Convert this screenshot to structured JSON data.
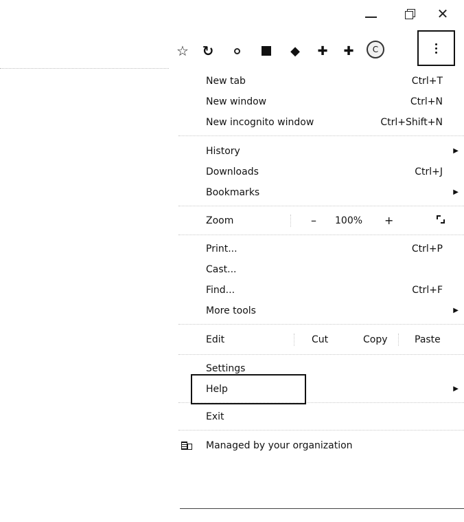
{
  "window_controls": {
    "minimize_icon": "minimize-icon",
    "restore_icon": "restore-icon",
    "close_glyph": "✕"
  },
  "toolbar": {
    "icons": [
      {
        "name": "star-icon",
        "glyph": "☆"
      },
      {
        "name": "refresh-icon",
        "glyph": "↻"
      },
      {
        "name": "circle-icon",
        "glyph": "○"
      },
      {
        "name": "pdf-icon",
        "glyph": ""
      },
      {
        "name": "diamond-icon",
        "glyph": "◆"
      },
      {
        "name": "extension-icon",
        "glyph": "✚"
      },
      {
        "name": "puzzle-icon",
        "glyph": "✚"
      },
      {
        "name": "profile-icon",
        "glyph": "C"
      }
    ],
    "menu_button_icon": "more-vert-icon"
  },
  "menu": {
    "new_tab": {
      "label": "New tab",
      "shortcut": "Ctrl+T"
    },
    "new_window": {
      "label": "New window",
      "shortcut": "Ctrl+N"
    },
    "new_incognito_window": {
      "label": "New incognito window",
      "shortcut": "Ctrl+Shift+N"
    },
    "history": {
      "label": "History"
    },
    "downloads": {
      "label": "Downloads",
      "shortcut": "Ctrl+J"
    },
    "bookmarks": {
      "label": "Bookmarks"
    },
    "zoom": {
      "label": "Zoom",
      "minus": "–",
      "value": "100%",
      "plus": "+"
    },
    "print": {
      "label": "Print...",
      "shortcut": "Ctrl+P"
    },
    "cast": {
      "label": "Cast..."
    },
    "find": {
      "label": "Find...",
      "shortcut": "Ctrl+F"
    },
    "more_tools": {
      "label": "More tools"
    },
    "edit": {
      "label": "Edit",
      "cut": "Cut",
      "copy": "Copy",
      "paste": "Paste"
    },
    "settings": {
      "label": "Settings"
    },
    "help": {
      "label": "Help"
    },
    "exit": {
      "label": "Exit"
    },
    "managed": {
      "label": "Managed by your organization"
    }
  }
}
